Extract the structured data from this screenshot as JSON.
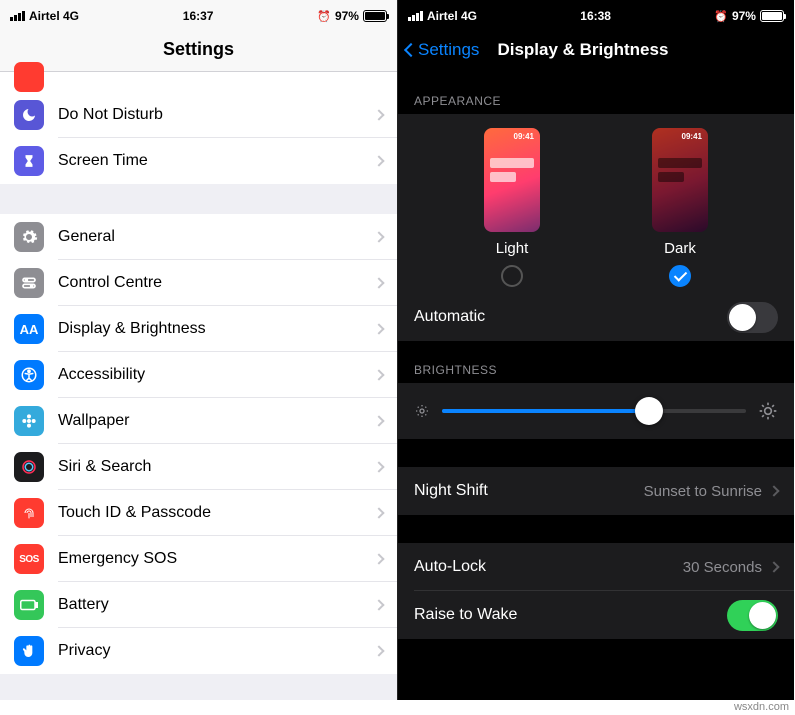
{
  "left": {
    "status": {
      "carrier": "Airtel 4G",
      "time": "16:37",
      "battery": "97%"
    },
    "title": "Settings",
    "items": [
      {
        "label": "Do Not Disturb"
      },
      {
        "label": "Screen Time"
      },
      {
        "label": "General"
      },
      {
        "label": "Control Centre"
      },
      {
        "label": "Display & Brightness"
      },
      {
        "label": "Accessibility"
      },
      {
        "label": "Wallpaper"
      },
      {
        "label": "Siri & Search"
      },
      {
        "label": "Touch ID & Passcode"
      },
      {
        "label": "Emergency SOS"
      },
      {
        "label": "Battery"
      },
      {
        "label": "Privacy"
      }
    ]
  },
  "right": {
    "status": {
      "carrier": "Airtel 4G",
      "time": "16:38",
      "battery": "97%"
    },
    "back": "Settings",
    "title": "Display & Brightness",
    "appearance_header": "APPEARANCE",
    "preview_time": "09:41",
    "light_label": "Light",
    "dark_label": "Dark",
    "automatic_label": "Automatic",
    "brightness_header": "BRIGHTNESS",
    "brightness_pct": 68,
    "night_shift_label": "Night Shift",
    "night_shift_value": "Sunset to Sunrise",
    "auto_lock_label": "Auto-Lock",
    "auto_lock_value": "30 Seconds",
    "raise_label": "Raise to Wake"
  },
  "watermark": "wsxdn.com"
}
